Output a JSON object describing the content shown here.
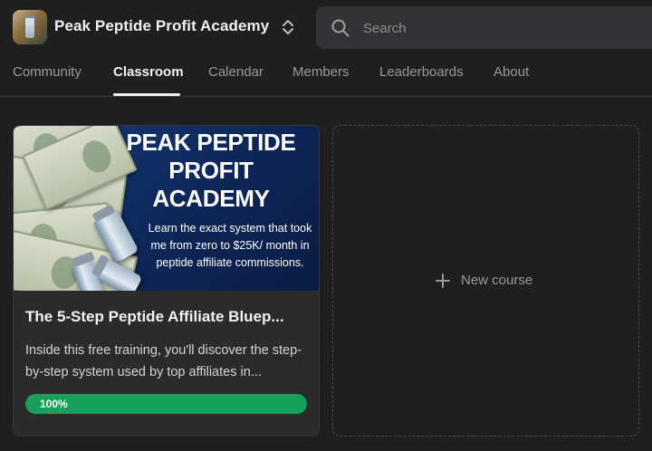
{
  "header": {
    "community_name": "Peak Peptide Profit Academy",
    "search_placeholder": "Search"
  },
  "tabs": [
    {
      "label": "Community",
      "active": false
    },
    {
      "label": "Classroom",
      "active": true
    },
    {
      "label": "Calendar",
      "active": false
    },
    {
      "label": "Members",
      "active": false
    },
    {
      "label": "Leaderboards",
      "active": false
    },
    {
      "label": "About",
      "active": false
    }
  ],
  "course": {
    "cover_title": "PEAK PEPTIDE PROFIT ACADEMY",
    "cover_subtitle": "Learn the exact system that took me from zero to $25K/ month in peptide affiliate commissions.",
    "title": "The 5-Step Peptide Affiliate Bluep...",
    "description": "Inside this free training, you'll discover the step-by-step system used by top affiliates in...",
    "progress_label": "100%",
    "progress_fraction": 1.0
  },
  "new_course": {
    "label": "New course"
  },
  "colors": {
    "background": "#1f1f1f",
    "progress_green": "#16a05a",
    "search_bg": "#333335"
  },
  "icons": {
    "switcher": "chevron-up-down-icon",
    "search": "search-icon",
    "add": "plus-icon"
  }
}
